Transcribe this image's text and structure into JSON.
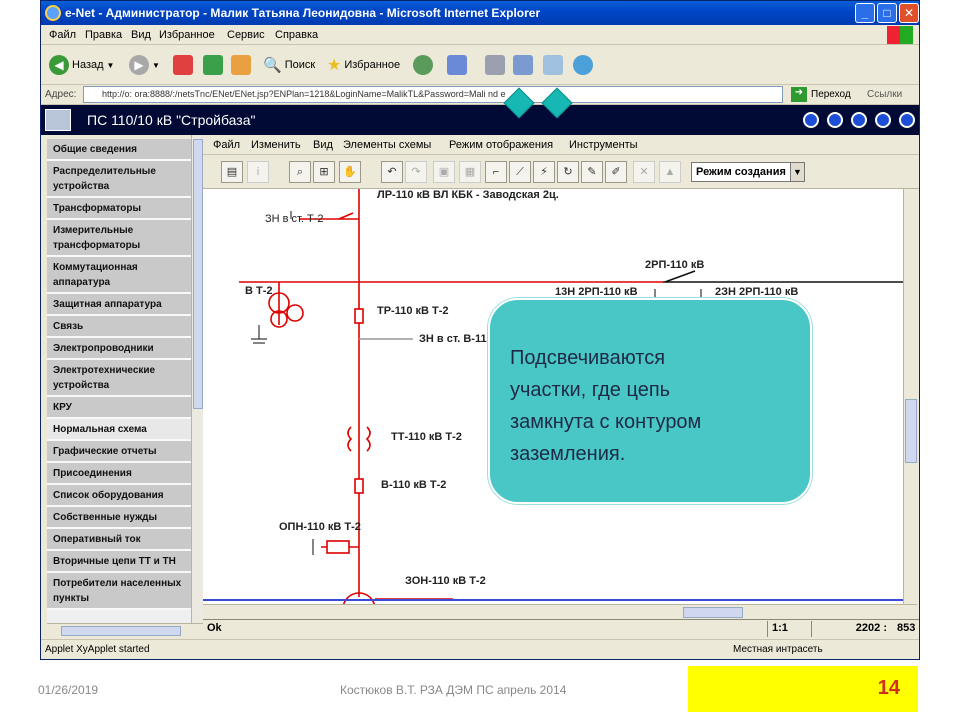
{
  "window": {
    "title": "e-Net - Администратор - Малик Татьяна Леонидовна - Microsoft Internet Explorer",
    "min": "_",
    "max": "□",
    "close": "✕"
  },
  "ie_menu": [
    "Файл",
    "Правка",
    "Вид",
    "Избранное",
    "Сервис",
    "Справка"
  ],
  "ie_toolbar": {
    "back": "Назад",
    "search": "Поиск",
    "favorites": "Избранное"
  },
  "address": {
    "label": "Адрес:",
    "url": "http://o: ora:8888/:/netsTnc/ENet/ENet.jsp?ENPlan=1218&LoginName=MalikTL&Password=Mali  nd  e",
    "go": "Переход",
    "links": "Ссылки"
  },
  "app": {
    "title": "ПС 110/10 кВ \"Стройбаза\"",
    "menu": [
      "Файл",
      "Изменить",
      "Вид",
      "Элементы схемы",
      "Режим отображения",
      "Инструменты"
    ],
    "mode_select": "Режим создания"
  },
  "sidebar": {
    "items": [
      {
        "label": "Общие сведения",
        "active": false
      },
      {
        "label": "Распределительные устройства",
        "active": false
      },
      {
        "label": "Трансформаторы",
        "active": false
      },
      {
        "label": "Измерительные трансформаторы",
        "active": false
      },
      {
        "label": "Коммутационная аппаратура",
        "active": false
      },
      {
        "label": "Защитная аппаратура",
        "active": false
      },
      {
        "label": "Связь",
        "active": false
      },
      {
        "label": "Электропроводники",
        "active": false
      },
      {
        "label": "Электротехнические устройства",
        "active": false
      },
      {
        "label": "КРУ",
        "active": false
      },
      {
        "label": "Нормальная схема",
        "active": true
      },
      {
        "label": "Графические отчеты",
        "active": false
      },
      {
        "label": "Присоединения",
        "active": false
      },
      {
        "label": "Список оборудования",
        "active": false
      },
      {
        "label": "Собственные нужды",
        "active": false
      },
      {
        "label": "Оперативный ток",
        "active": false
      },
      {
        "label": "Вторичные цепи ТТ и ТН",
        "active": false
      },
      {
        "label": "Потребители населенных пункты",
        "active": false
      }
    ]
  },
  "diagram": {
    "labels": {
      "lr110": "ЛР-110 кВ ВЛ КБК - Заводская 2ц.",
      "zn_t2": "ЗН в ст. Т-2",
      "rp2": "2РП-110 кВ",
      "bt2": "В Т-2",
      "zn13": "13Н 2РП-110 кВ",
      "zn23": "2ЗН 2РП-110 кВ",
      "tr110": "ТР-110 кВ Т-2",
      "zn_v110": "ЗН в ст. В-110 кВ",
      "tt110": "ТТ-110 кВ Т-2",
      "v110": "В-110 кВ Т-2",
      "opn": "ОПН-110 кВ Т-2",
      "zon": "ЗОН-110 кВ Т-2"
    }
  },
  "status": {
    "ok": "Ok",
    "scale": "1:1",
    "coords": "2202 :",
    "coords2": "853"
  },
  "ie_status": {
    "left": "Applet XyApplet started",
    "right": "Местная интрасеть"
  },
  "callout": "Подсвечиваются\nучастки, где цепь\nзамкнута с контуром\nзаземления.",
  "footer": {
    "date": "01/26/2019",
    "center": "Костюков В.Т. РЗА ДЭМ ПС апрель 2014",
    "page": "14"
  },
  "colors": {
    "titlebar": "#0046c8",
    "app_header": "#000a35",
    "circuit_red": "#dd0000",
    "callout": "#49c6c6",
    "page_badge": "#ffff00"
  }
}
